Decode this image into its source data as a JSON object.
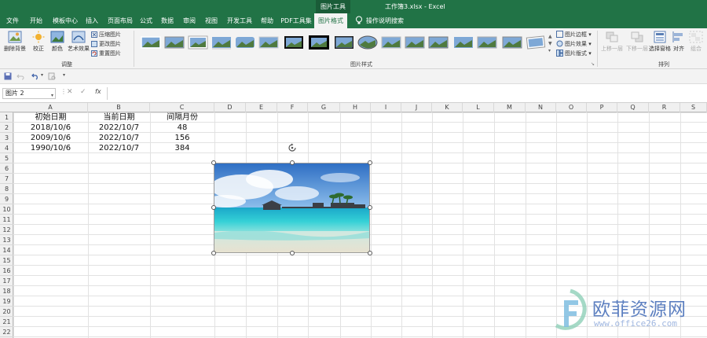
{
  "titlebar": {
    "context_tab": "图片工具",
    "document_title": "工作簿3.xlsx  -  Excel"
  },
  "tabs": [
    {
      "label": "文件"
    },
    {
      "label": "开始"
    },
    {
      "label": "模板中心"
    },
    {
      "label": "插入"
    },
    {
      "label": "页面布局"
    },
    {
      "label": "公式"
    },
    {
      "label": "数据"
    },
    {
      "label": "审阅"
    },
    {
      "label": "视图"
    },
    {
      "label": "开发工具"
    },
    {
      "label": "帮助"
    },
    {
      "label": "PDF工具集"
    },
    {
      "label": "图片格式"
    }
  ],
  "tell_me": "操作说明搜索",
  "ribbon": {
    "remove_bg": "删除背景",
    "correct": "校正",
    "color": "颜色",
    "art_effects": "艺术效果",
    "compress": "压缩图片",
    "change": "更改图片",
    "reset": "重置图片",
    "adjust_group": "调整",
    "styles_group": "图片样式",
    "border": "图片边框",
    "effects": "图片效果",
    "layout": "图片版式",
    "bring_forward": "上移一层",
    "send_backward": "下移一层",
    "selection_pane": "选择窗格",
    "align": "对齐",
    "group": "组合",
    "arrange_group": "排列"
  },
  "formula_bar": {
    "name_box": "图片 2",
    "fx": "fx",
    "value": ""
  },
  "columns": [
    "A",
    "B",
    "C",
    "D",
    "E",
    "F",
    "G",
    "H",
    "I",
    "J",
    "K",
    "L",
    "M",
    "N",
    "O",
    "P",
    "Q",
    "R",
    "S"
  ],
  "rows": [
    "1",
    "2",
    "3",
    "4",
    "5",
    "6",
    "7",
    "8",
    "9",
    "10",
    "11",
    "12",
    "13",
    "14",
    "15",
    "16",
    "17",
    "18",
    "19",
    "20",
    "21",
    "22"
  ],
  "table": {
    "headers": [
      "初始日期",
      "当前日期",
      "间隔月份"
    ],
    "data": [
      [
        "2018/10/6",
        "2022/10/7",
        "48"
      ],
      [
        "2009/10/6",
        "2022/10/7",
        "156"
      ],
      [
        "1990/10/6",
        "2022/10/7",
        "384"
      ]
    ]
  },
  "watermark": {
    "text": "欧菲资源网",
    "url": "www.office26.com"
  },
  "colors": {
    "excel_green": "#217346",
    "watermark_blue": "#5c7fc0"
  }
}
